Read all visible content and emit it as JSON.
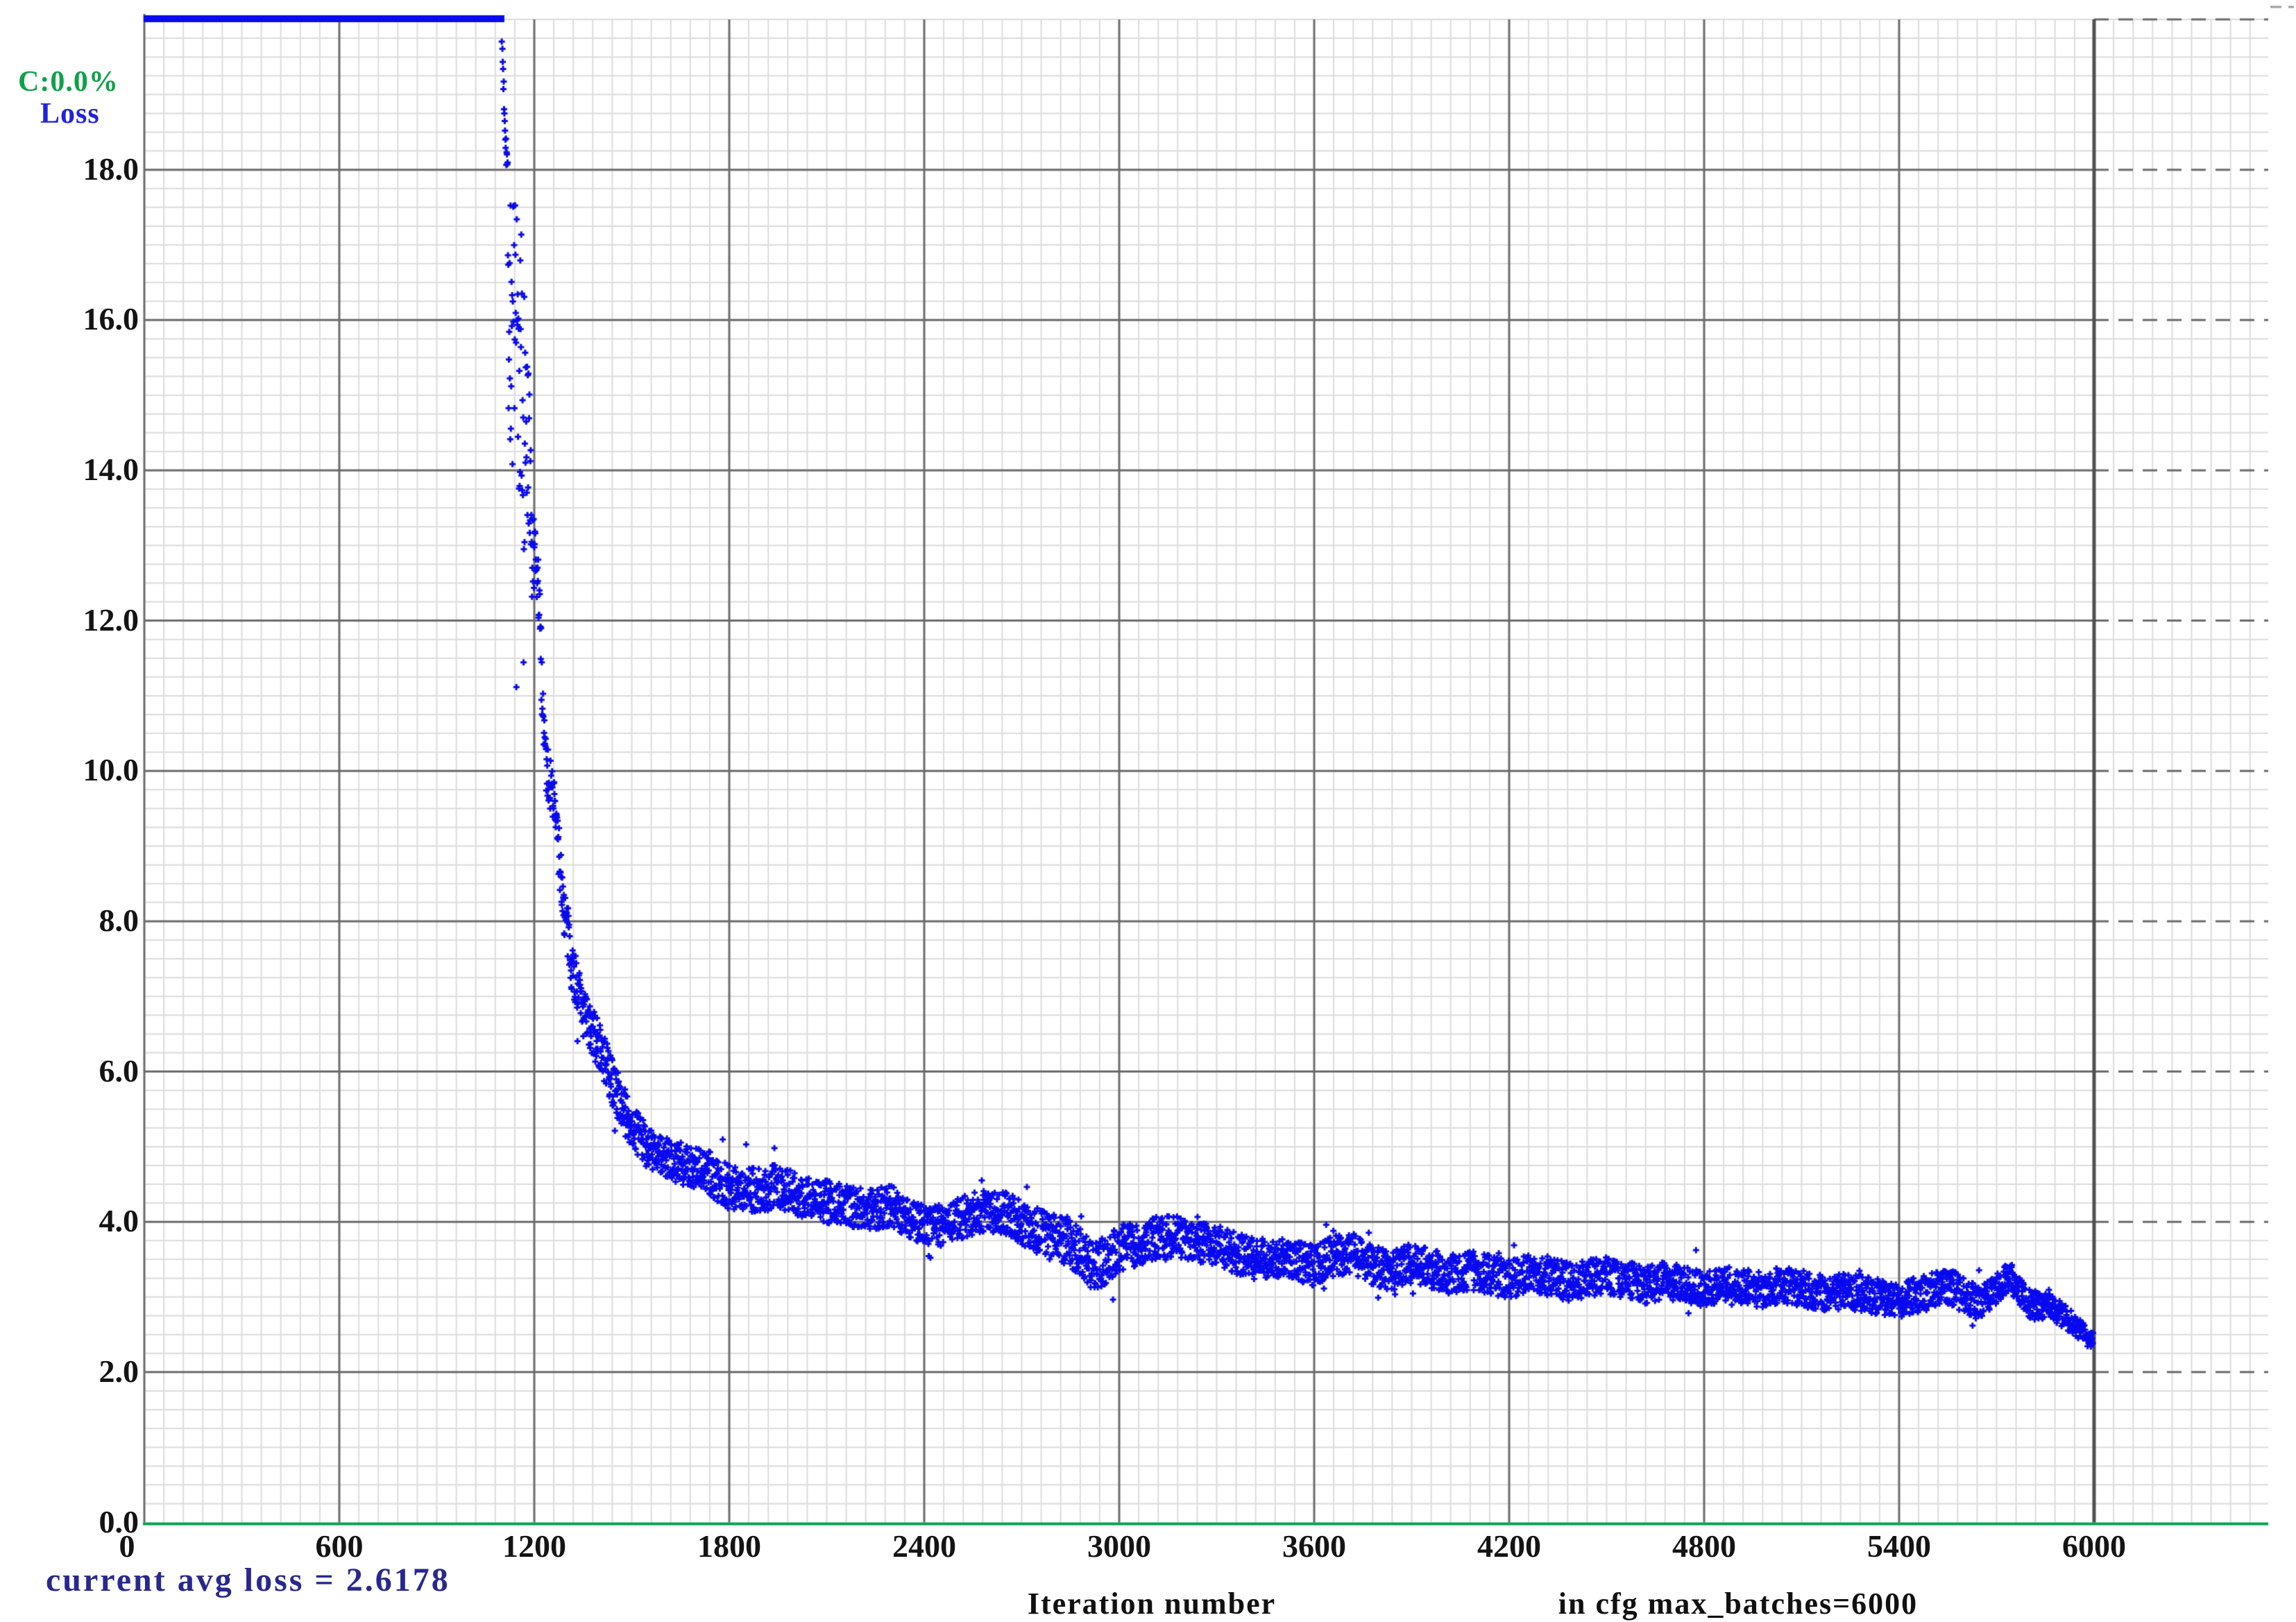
{
  "chart_data": {
    "type": "scatter",
    "title": "Loss",
    "progress_label": "C:0.0%",
    "xlabel": "Iteration number",
    "config_note": "in cfg max_batches=6000",
    "status_line": "current avg loss = 2.6178",
    "current_avg_loss": 2.6178,
    "max_batches": 6000,
    "xlim": [
      0,
      6536
    ],
    "ylim": [
      0,
      20
    ],
    "grid": "major+minor",
    "minor_x_step": 60,
    "minor_y_step": 0.25,
    "x_ticks": [
      {
        "value": 0,
        "label": "0"
      },
      {
        "value": 600,
        "label": "600"
      },
      {
        "value": 1200,
        "label": "1200"
      },
      {
        "value": 1800,
        "label": "1800"
      },
      {
        "value": 2400,
        "label": "2400"
      },
      {
        "value": 3000,
        "label": "3000"
      },
      {
        "value": 3600,
        "label": "3600"
      },
      {
        "value": 4200,
        "label": "4200"
      },
      {
        "value": 4800,
        "label": "4800"
      },
      {
        "value": 5400,
        "label": "5400"
      },
      {
        "value": 6000,
        "label": "6000"
      }
    ],
    "y_ticks": [
      {
        "value": 18,
        "label": "18.0"
      },
      {
        "value": 16,
        "label": "16.0"
      },
      {
        "value": 14,
        "label": "14.0"
      },
      {
        "value": 12,
        "label": "12.0"
      },
      {
        "value": 10,
        "label": "10.0"
      },
      {
        "value": 8,
        "label": "8.0"
      },
      {
        "value": 6,
        "label": "6.0"
      },
      {
        "value": 4,
        "label": "4.0"
      },
      {
        "value": 2,
        "label": "2.0"
      },
      {
        "value": 0,
        "label": "0.0"
      }
    ],
    "major_y_gridlines": [
      2,
      4,
      6,
      8,
      10,
      12,
      14,
      16,
      18,
      20
    ],
    "major_x_gridlines": [
      600,
      1200,
      1800,
      2400,
      3000,
      3600,
      4200,
      4800,
      5400,
      6000
    ],
    "max_batches_vline_x": 6000,
    "clipped_line": {
      "x_start": 0,
      "x_end": 1108,
      "y_display": 20,
      "note": "loss above chart top for iterations 0-1108, drawn clipped as thick line at top edge"
    },
    "series": [
      {
        "name": "Loss",
        "marker": "plus",
        "iter_start": 1100,
        "iter_end": 5997,
        "iter_step": 1,
        "mean_curve": [
          [
            1100,
            19.9
          ],
          [
            1103,
            19.45
          ],
          [
            1106,
            19.05
          ],
          [
            1110,
            18.65
          ],
          [
            1114,
            18.3
          ],
          [
            1118,
            17.9
          ],
          [
            1122,
            16.0
          ],
          [
            1135,
            15.6
          ],
          [
            1150,
            15.4
          ],
          [
            1165,
            15.0
          ],
          [
            1178,
            14.4
          ],
          [
            1188,
            13.1
          ],
          [
            1196,
            12.8
          ],
          [
            1205,
            12.6
          ],
          [
            1212,
            12.45
          ],
          [
            1218,
            11.9
          ],
          [
            1224,
            11.1
          ],
          [
            1230,
            10.6
          ],
          [
            1238,
            10.0
          ],
          [
            1248,
            9.85
          ],
          [
            1258,
            9.7
          ],
          [
            1268,
            9.3
          ],
          [
            1280,
            8.7
          ],
          [
            1292,
            8.15
          ],
          [
            1305,
            7.75
          ],
          [
            1320,
            7.35
          ],
          [
            1340,
            6.95
          ],
          [
            1365,
            6.6
          ],
          [
            1395,
            6.4
          ],
          [
            1420,
            6.1
          ],
          [
            1450,
            5.75
          ],
          [
            1480,
            5.45
          ],
          [
            1510,
            5.2
          ],
          [
            1550,
            5.0
          ],
          [
            1600,
            4.85
          ],
          [
            1650,
            4.78
          ],
          [
            1700,
            4.72
          ],
          [
            1750,
            4.62
          ],
          [
            1800,
            4.45
          ],
          [
            1850,
            4.42
          ],
          [
            1900,
            4.42
          ],
          [
            1950,
            4.48
          ],
          [
            2000,
            4.38
          ],
          [
            2060,
            4.32
          ],
          [
            2120,
            4.25
          ],
          [
            2180,
            4.2
          ],
          [
            2240,
            4.18
          ],
          [
            2300,
            4.2
          ],
          [
            2360,
            4.05
          ],
          [
            2420,
            3.92
          ],
          [
            2480,
            4.0
          ],
          [
            2540,
            4.1
          ],
          [
            2600,
            4.15
          ],
          [
            2660,
            4.1
          ],
          [
            2720,
            3.95
          ],
          [
            2780,
            3.8
          ],
          [
            2840,
            3.75
          ],
          [
            2880,
            3.6
          ],
          [
            2920,
            3.4
          ],
          [
            2960,
            3.5
          ],
          [
            3000,
            3.65
          ],
          [
            3060,
            3.7
          ],
          [
            3120,
            3.8
          ],
          [
            3180,
            3.8
          ],
          [
            3240,
            3.72
          ],
          [
            3300,
            3.7
          ],
          [
            3360,
            3.58
          ],
          [
            3420,
            3.5
          ],
          [
            3480,
            3.52
          ],
          [
            3540,
            3.48
          ],
          [
            3600,
            3.42
          ],
          [
            3660,
            3.55
          ],
          [
            3720,
            3.58
          ],
          [
            3780,
            3.42
          ],
          [
            3840,
            3.35
          ],
          [
            3900,
            3.45
          ],
          [
            3960,
            3.38
          ],
          [
            4020,
            3.3
          ],
          [
            4080,
            3.36
          ],
          [
            4140,
            3.3
          ],
          [
            4200,
            3.24
          ],
          [
            4260,
            3.32
          ],
          [
            4320,
            3.28
          ],
          [
            4380,
            3.2
          ],
          [
            4440,
            3.24
          ],
          [
            4500,
            3.3
          ],
          [
            4560,
            3.22
          ],
          [
            4620,
            3.16
          ],
          [
            4680,
            3.22
          ],
          [
            4740,
            3.16
          ],
          [
            4800,
            3.1
          ],
          [
            4860,
            3.18
          ],
          [
            4920,
            3.13
          ],
          [
            4980,
            3.1
          ],
          [
            5040,
            3.16
          ],
          [
            5100,
            3.12
          ],
          [
            5160,
            3.05
          ],
          [
            5220,
            3.08
          ],
          [
            5280,
            3.06
          ],
          [
            5340,
            3.0
          ],
          [
            5400,
            2.96
          ],
          [
            5460,
            3.04
          ],
          [
            5520,
            3.1
          ],
          [
            5560,
            3.12
          ],
          [
            5600,
            3.02
          ],
          [
            5640,
            2.92
          ],
          [
            5680,
            3.0
          ],
          [
            5720,
            3.2
          ],
          [
            5745,
            3.26
          ],
          [
            5770,
            3.08
          ],
          [
            5800,
            2.92
          ],
          [
            5830,
            2.86
          ],
          [
            5860,
            2.94
          ],
          [
            5890,
            2.8
          ],
          [
            5920,
            2.7
          ],
          [
            5950,
            2.58
          ],
          [
            5975,
            2.48
          ],
          [
            5997,
            2.42
          ]
        ],
        "noise_band": [
          [
            1100,
            0.2
          ],
          [
            1118,
            0.3
          ],
          [
            1121,
            2.0
          ],
          [
            1160,
            2.2
          ],
          [
            1185,
            1.6
          ],
          [
            1195,
            0.7
          ],
          [
            1205,
            0.5
          ],
          [
            1215,
            0.45
          ],
          [
            1228,
            0.4
          ],
          [
            1240,
            0.35
          ],
          [
            1300,
            0.4
          ],
          [
            1360,
            0.35
          ],
          [
            1420,
            0.32
          ],
          [
            1500,
            0.3
          ],
          [
            1600,
            0.28
          ],
          [
            1800,
            0.3
          ],
          [
            2200,
            0.28
          ],
          [
            2600,
            0.28
          ],
          [
            2920,
            0.33
          ],
          [
            3200,
            0.27
          ],
          [
            3600,
            0.27
          ],
          [
            4000,
            0.26
          ],
          [
            4400,
            0.26
          ],
          [
            4800,
            0.24
          ],
          [
            5200,
            0.24
          ],
          [
            5600,
            0.24
          ],
          [
            5750,
            0.2
          ],
          [
            5850,
            0.18
          ],
          [
            5940,
            0.15
          ],
          [
            5997,
            0.12
          ]
        ]
      }
    ],
    "colors": {
      "point": "#0a0aee",
      "clipped_line": "#0a0aee",
      "bottom_axis_green": "#00a14e",
      "minor_grid": "#dcdcdc",
      "major_grid": "#6b6b6b",
      "max_batches_line": "#4f4f4f",
      "progress_text": "#0fa14a",
      "loss_title_text": "#2222dd",
      "status_text": "#28288e",
      "tick_text": "#141414",
      "axis_label_text": "#101010",
      "background": "#ffffff"
    }
  }
}
